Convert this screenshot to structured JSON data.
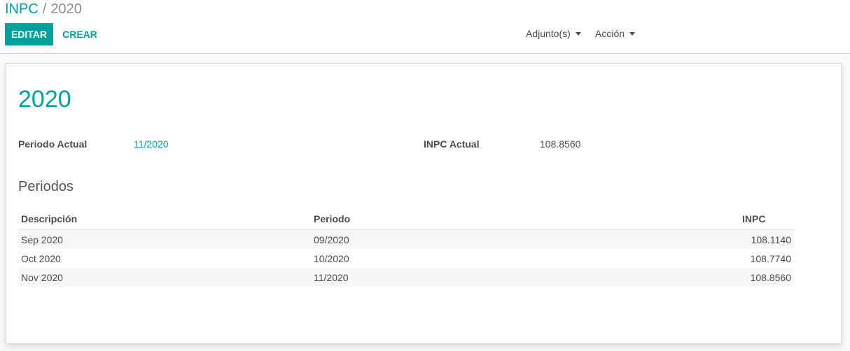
{
  "breadcrumb": {
    "parent": "INPC",
    "separator": "/",
    "current": "2020"
  },
  "toolbar": {
    "edit_label": "EDITAR",
    "create_label": "CREAR",
    "attachments_label": "Adjunto(s)",
    "action_label": "Acción"
  },
  "record": {
    "title": "2020",
    "fields": {
      "periodo_actual_label": "Periodo Actual",
      "periodo_actual_value": "11/2020",
      "inpc_actual_label": "INPC Actual",
      "inpc_actual_value": "108.8560"
    },
    "periodos": {
      "section_title": "Periodos",
      "columns": [
        "Descripción",
        "Periodo",
        "INPC"
      ],
      "rows": [
        {
          "descripcion": "Sep 2020",
          "periodo": "09/2020",
          "inpc": "108.1140"
        },
        {
          "descripcion": "Oct 2020",
          "periodo": "10/2020",
          "inpc": "108.7740"
        },
        {
          "descripcion": "Nov 2020",
          "periodo": "11/2020",
          "inpc": "108.8560"
        }
      ]
    }
  },
  "colors": {
    "accent": "#00a09d",
    "text": "#4c4c4c",
    "muted": "#8f8f8f"
  }
}
